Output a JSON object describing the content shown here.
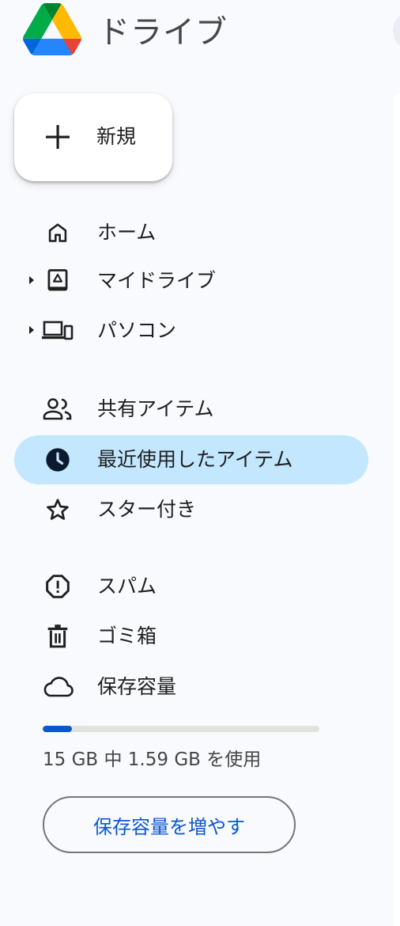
{
  "app": {
    "title": "ドライブ"
  },
  "new_button": {
    "label": "新規"
  },
  "nav": {
    "home": "ホーム",
    "my_drive": "マイドライブ",
    "computers": "パソコン",
    "shared": "共有アイテム",
    "recent": "最近使用したアイテム",
    "starred": "スター付き",
    "spam": "スパム",
    "trash": "ゴミ箱",
    "storage": "保存容量"
  },
  "active_item": "recent",
  "storage": {
    "used_fraction": 0.106,
    "text": "15 GB 中 1.59 GB を使用",
    "upgrade_label": "保存容量を増やす"
  },
  "colors": {
    "accent": "#0b57d0",
    "active_bg": "#c2e7ff",
    "sidebar_bg": "#f8fafd"
  },
  "icons": {
    "home": "home-icon",
    "my_drive": "drive-folder-icon",
    "computers": "computer-icon",
    "shared": "people-icon",
    "recent": "clock-icon",
    "starred": "star-icon",
    "spam": "report-icon",
    "trash": "trash-icon",
    "storage": "cloud-icon"
  }
}
